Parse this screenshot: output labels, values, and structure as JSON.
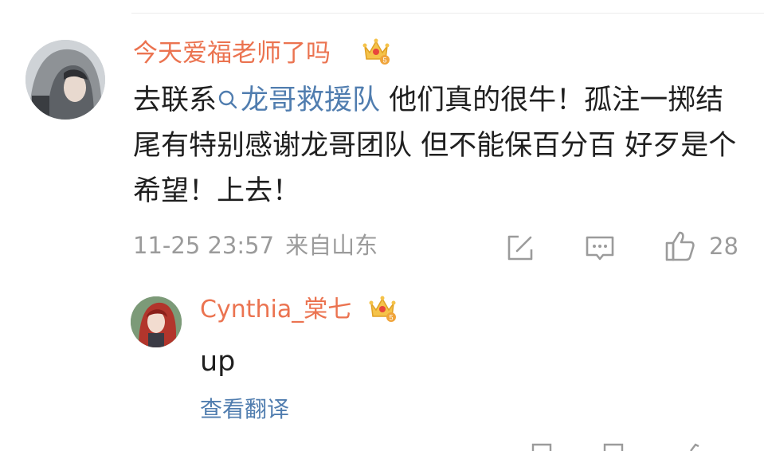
{
  "comment": {
    "username": "今天爱福老师了吗",
    "badge_icon": "vip-crown-icon",
    "text_before_mention": "去联系",
    "mention": "龙哥救援队",
    "mention_icon": "search-icon",
    "text_after_mention": " 他们真的很牛！孤注一掷结尾有特别感谢龙哥团队 但不能保百分百 好歹是个希望！上去！",
    "timestamp": "11-25 23:57",
    "location": "来自山东",
    "like_count": "28"
  },
  "reply": {
    "username": "Cynthia_棠七",
    "badge_icon": "vip-crown-icon",
    "text": "up",
    "translate_label": "查看翻译"
  },
  "colors": {
    "username": "#eb7350",
    "link": "#507daf",
    "meta": "#9b9b9b",
    "text": "#1f1f1f"
  }
}
